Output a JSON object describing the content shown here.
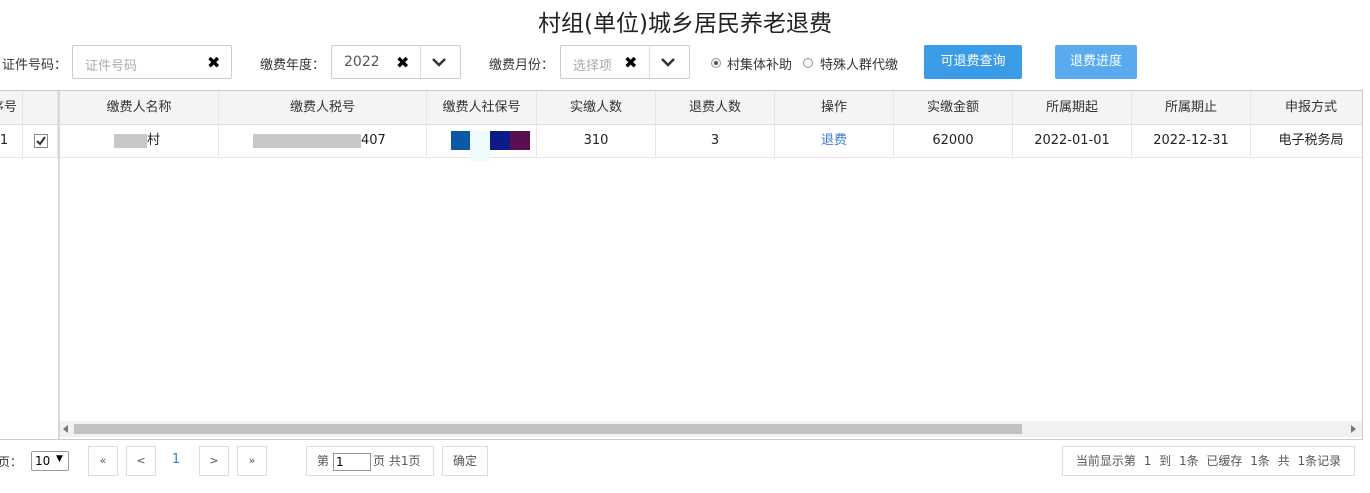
{
  "title": "村组(单位)城乡居民养老退费",
  "filters": {
    "id_label": "证件号码：",
    "id_placeholder": "证件号码",
    "year_label": "缴费年度：",
    "year_value": "2022",
    "month_label": "缴费月份：",
    "month_placeholder": "选择项",
    "radio_village": "村集体补助",
    "radio_special": "特殊人群代缴",
    "query_button": "可退费查询",
    "progress_button": "退费进度",
    "clear_icon": "✖",
    "dropdown_icon": "chevron-down"
  },
  "table": {
    "seq_header": "序号",
    "columns": [
      "缴费人名称",
      "缴费人税号",
      "缴费人社保号",
      "实缴人数",
      "退费人数",
      "操作",
      "实缴金额",
      "所属期起",
      "所属期止",
      "申报方式"
    ],
    "row": {
      "seq": "1",
      "checked": true,
      "name_suffix": "村",
      "tax_suffix": "407",
      "paid_count": "310",
      "refund_count": "3",
      "action": "退费",
      "amount": "62000",
      "period_start": "2022-01-01",
      "period_end": "2022-12-31",
      "declare_method": "电子税务局"
    }
  },
  "pager": {
    "per_page_label": "每页：",
    "per_page_value": "10",
    "first": "«",
    "prev": "<",
    "current": "1",
    "next": ">",
    "last": "»",
    "page_prefix": "第",
    "page_input": "1",
    "page_suffix": "页 共1页",
    "confirm": "确定",
    "status_text": "当前显示第 1 到 1条 已缓存 1条 共 1条记录"
  },
  "colors": {
    "primary_button": "#3a9be6",
    "secondary_button": "#5aaaf0",
    "link": "#3b7ed6",
    "accent_blue": "#0c5aa6",
    "navy": "#0d1a8a",
    "purple": "#5a1050"
  }
}
